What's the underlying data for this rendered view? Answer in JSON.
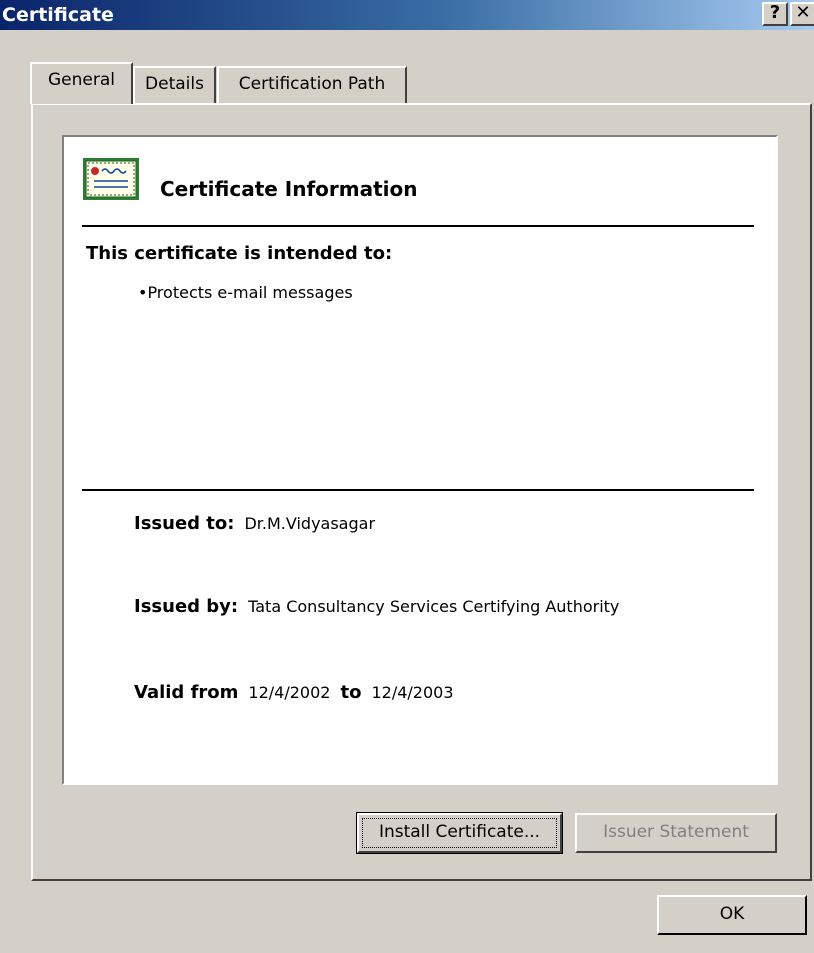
{
  "window": {
    "title": "Certificate",
    "help_label": "?",
    "close_label": "✕"
  },
  "tabs": [
    {
      "label": "General"
    },
    {
      "label": "Details"
    },
    {
      "label": "Certification Path"
    }
  ],
  "info": {
    "icon": "certificate-icon",
    "title": "Certificate Information",
    "intended_heading": "This certificate is intended to:",
    "purposes": [
      "•Protects e-mail messages"
    ],
    "issued_to_label": "Issued to:",
    "issued_to_value": "Dr.M.Vidyasagar",
    "issued_by_label": "Issued by:",
    "issued_by_value": "Tata Consultancy Services Certifying Authority",
    "valid_from_label": "Valid from",
    "valid_from_value": "12/4/2002",
    "valid_to_label": "to",
    "valid_to_value": "12/4/2003"
  },
  "buttons": {
    "install": "Install Certificate...",
    "issuer_statement": "Issuer Statement",
    "ok": "OK"
  },
  "colors": {
    "titlebar_start": "#0a246a",
    "titlebar_end": "#a6caf0",
    "dialog_bg": "#d4d0c8",
    "disabled_text": "#808080"
  }
}
